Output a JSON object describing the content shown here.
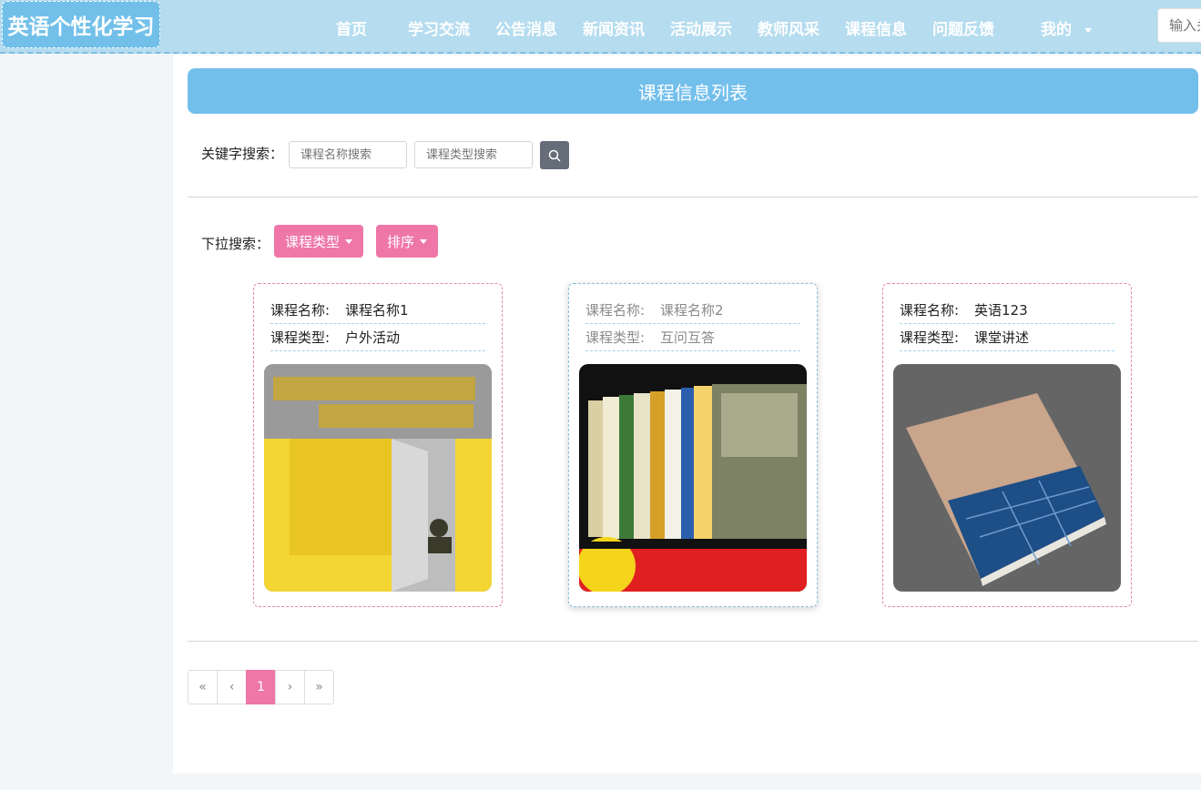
{
  "brand": {
    "logo_text": "英语个性化学习"
  },
  "nav": {
    "items": [
      "首页",
      "学习交流",
      "公告消息",
      "新闻资讯",
      "活动展示",
      "教师风采",
      "课程信息",
      "问题反馈"
    ],
    "mine_label": "我的",
    "search_placeholder": "输入关键字"
  },
  "page": {
    "title": "课程信息列表",
    "keyword_label": "关键字搜索：",
    "name_placeholder": "课程名称搜索",
    "type_placeholder": "课程类型搜索",
    "dropdown_label": "下拉搜索：",
    "type_dropdown": "课程类型",
    "sort_dropdown": "排序"
  },
  "cards": [
    {
      "name_key": "课程名称:",
      "name": "课程名称1",
      "type_key": "课程类型:",
      "type": "户外活动",
      "cover": "yellow-book-cover-image"
    },
    {
      "name_key": "课程名称:",
      "name": "课程名称2",
      "type_key": "课程类型:",
      "type": "互问互答",
      "cover": "book-spines-image"
    },
    {
      "name_key": "课程名称:",
      "name": "英语123",
      "type_key": "课程类型:",
      "type": "课堂讲述",
      "cover": "grey-book-mockup-image"
    }
  ],
  "pagination": {
    "first": "«",
    "prev": "‹",
    "current": "1",
    "next": "›",
    "last": "»"
  },
  "colors": {
    "topbar": "#b5dcef",
    "accent_blue": "#73bfec",
    "accent_pink": "#ee77a8",
    "search_btn": "#656d78"
  }
}
